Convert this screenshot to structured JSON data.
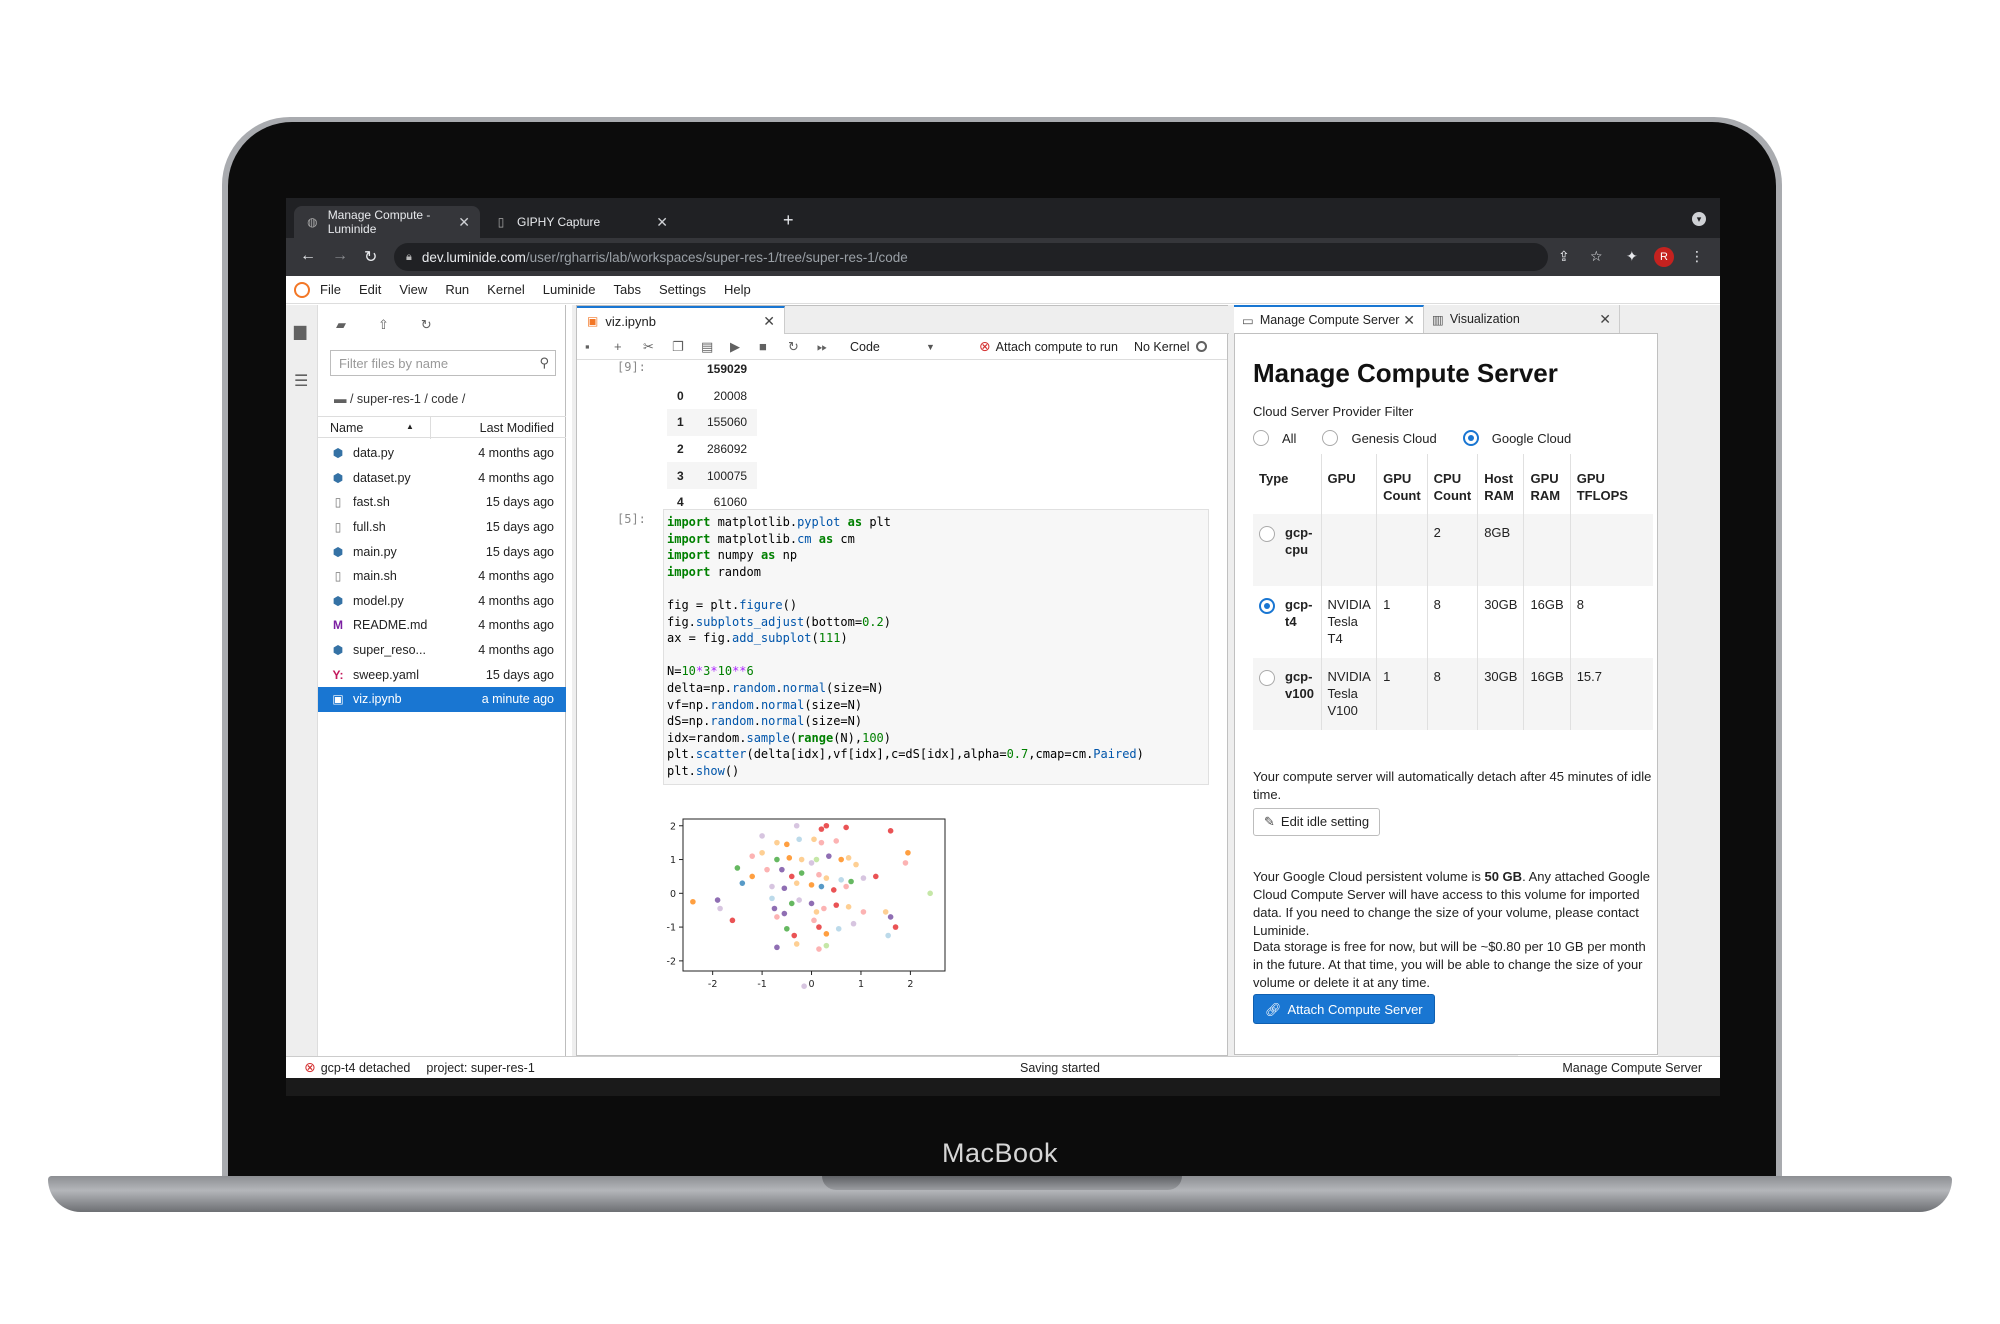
{
  "device": {
    "brand": "MacBook"
  },
  "browser": {
    "tabs": [
      {
        "title": "Manage Compute - Luminide",
        "active": true
      },
      {
        "title": "GIPHY Capture",
        "active": false
      }
    ],
    "url_host": "dev.luminide.com",
    "url_path": "/user/rgharris/lab/workspaces/super-res-1/tree/super-res-1/code",
    "profile_initial": "R"
  },
  "menubar": [
    "File",
    "Edit",
    "View",
    "Run",
    "Kernel",
    "Luminide",
    "Tabs",
    "Settings",
    "Help"
  ],
  "filebrowser": {
    "filter_placeholder": "Filter files by name",
    "breadcrumb": "/ super-res-1 / code /",
    "col_name": "Name",
    "col_modified": "Last Modified",
    "files": [
      {
        "name": "data.py",
        "modified": "4 months ago",
        "icon": "python-icon"
      },
      {
        "name": "dataset.py",
        "modified": "4 months ago",
        "icon": "python-icon"
      },
      {
        "name": "fast.sh",
        "modified": "15 days ago",
        "icon": "file-icon"
      },
      {
        "name": "full.sh",
        "modified": "15 days ago",
        "icon": "file-icon"
      },
      {
        "name": "main.py",
        "modified": "15 days ago",
        "icon": "python-icon"
      },
      {
        "name": "main.sh",
        "modified": "4 months ago",
        "icon": "file-icon"
      },
      {
        "name": "model.py",
        "modified": "4 months ago",
        "icon": "python-icon"
      },
      {
        "name": "README.md",
        "modified": "4 months ago",
        "icon": "markdown-icon"
      },
      {
        "name": "super_reso...",
        "modified": "4 months ago",
        "icon": "python-icon"
      },
      {
        "name": "sweep.yaml",
        "modified": "15 days ago",
        "icon": "yaml-icon"
      },
      {
        "name": "viz.ipynb",
        "modified": "a minute ago",
        "icon": "notebook-icon",
        "selected": true
      }
    ]
  },
  "notebook": {
    "tab_title": "viz.ipynb",
    "cell_type": "Code",
    "attach_label": "Attach compute to run",
    "kernel": "No Kernel",
    "output_prompt": "[9]:",
    "dataframe": {
      "header": "159029",
      "rows": [
        {
          "index": "0",
          "value": "20008"
        },
        {
          "index": "1",
          "value": "155060"
        },
        {
          "index": "2",
          "value": "286092"
        },
        {
          "index": "3",
          "value": "100075"
        },
        {
          "index": "4",
          "value": "61060"
        }
      ]
    },
    "code_prompt": "[5]:",
    "code_lines": [
      "import matplotlib.pyplot as plt",
      "import matplotlib.cm as cm",
      "import numpy as np",
      "import random",
      "",
      "fig = plt.figure()",
      "fig.subplots_adjust(bottom=0.2)",
      "ax = fig.add_subplot(111)",
      "",
      "N=10*3*10**6",
      "delta=np.random.normal(size=N)",
      "vf=np.random.normal(size=N)",
      "dS=np.random.normal(size=N)",
      "idx=random.sample(range(N),100)",
      "plt.scatter(delta[idx],vf[idx],c=dS[idx],alpha=0.7,cmap=cm.Paired)",
      "plt.show()"
    ]
  },
  "chart_data": {
    "type": "scatter",
    "xlim": [
      -2.6,
      2.7
    ],
    "ylim": [
      -2.3,
      2.2
    ],
    "xticks": [
      "-2",
      "-1",
      "0",
      "1",
      "2"
    ],
    "yticks": [
      "2",
      "1",
      "0",
      "-1",
      "-2"
    ],
    "xtick_values": [
      -2,
      -1,
      0,
      1,
      2
    ],
    "ytick_values": [
      2,
      1,
      0,
      -1,
      -2
    ],
    "colormap": [
      "#a6cee3",
      "#1f78b4",
      "#b2df8a",
      "#33a02c",
      "#fb9a99",
      "#e31a1c",
      "#fdbf6f",
      "#ff7f00",
      "#cab2d6",
      "#6a3d9a",
      "#ffff99",
      "#b15928"
    ],
    "points": [
      {
        "x": -1.0,
        "y": 1.7,
        "c": 8
      },
      {
        "x": -0.3,
        "y": 2.0,
        "c": 8
      },
      {
        "x": 0.2,
        "y": 1.9,
        "c": 5
      },
      {
        "x": 0.3,
        "y": 2.0,
        "c": 5
      },
      {
        "x": 0.7,
        "y": 1.95,
        "c": 5
      },
      {
        "x": 1.6,
        "y": 1.85,
        "c": 5
      },
      {
        "x": -0.7,
        "y": 1.5,
        "c": 6
      },
      {
        "x": -0.5,
        "y": 1.45,
        "c": 7
      },
      {
        "x": -0.25,
        "y": 1.6,
        "c": 0
      },
      {
        "x": 0.05,
        "y": 1.6,
        "c": 6
      },
      {
        "x": 0.2,
        "y": 1.5,
        "c": 4
      },
      {
        "x": 0.5,
        "y": 1.55,
        "c": 4
      },
      {
        "x": 1.95,
        "y": 1.2,
        "c": 7
      },
      {
        "x": 1.9,
        "y": 0.9,
        "c": 4
      },
      {
        "x": -1.2,
        "y": 1.1,
        "c": 4
      },
      {
        "x": -1.0,
        "y": 1.2,
        "c": 6
      },
      {
        "x": -0.7,
        "y": 1.0,
        "c": 3
      },
      {
        "x": -0.45,
        "y": 1.05,
        "c": 7
      },
      {
        "x": -0.2,
        "y": 1.0,
        "c": 6
      },
      {
        "x": 0.0,
        "y": 0.9,
        "c": 8
      },
      {
        "x": 0.1,
        "y": 1.0,
        "c": 2
      },
      {
        "x": 0.35,
        "y": 1.1,
        "c": 9
      },
      {
        "x": 0.6,
        "y": 1.0,
        "c": 7
      },
      {
        "x": 0.75,
        "y": 1.05,
        "c": 6
      },
      {
        "x": 0.9,
        "y": 0.85,
        "c": 6
      },
      {
        "x": 1.3,
        "y": 0.5,
        "c": 5
      },
      {
        "x": -1.5,
        "y": 0.75,
        "c": 3
      },
      {
        "x": -1.2,
        "y": 0.5,
        "c": 7
      },
      {
        "x": -0.9,
        "y": 0.7,
        "c": 4
      },
      {
        "x": -0.6,
        "y": 0.7,
        "c": 9
      },
      {
        "x": -0.4,
        "y": 0.5,
        "c": 5
      },
      {
        "x": -0.2,
        "y": 0.6,
        "c": 3
      },
      {
        "x": 0.15,
        "y": 0.55,
        "c": 4
      },
      {
        "x": 0.3,
        "y": 0.45,
        "c": 6
      },
      {
        "x": 0.6,
        "y": 0.4,
        "c": 0
      },
      {
        "x": 0.8,
        "y": 0.35,
        "c": 3
      },
      {
        "x": 1.05,
        "y": 0.45,
        "c": 8
      },
      {
        "x": -1.4,
        "y": 0.3,
        "c": 1
      },
      {
        "x": -0.8,
        "y": 0.2,
        "c": 8
      },
      {
        "x": -0.55,
        "y": 0.15,
        "c": 9
      },
      {
        "x": -0.3,
        "y": 0.3,
        "c": 6
      },
      {
        "x": 0.0,
        "y": 0.25,
        "c": 7
      },
      {
        "x": 0.2,
        "y": 0.2,
        "c": 1
      },
      {
        "x": 0.45,
        "y": 0.1,
        "c": 5
      },
      {
        "x": 0.7,
        "y": 0.2,
        "c": 4
      },
      {
        "x": 2.4,
        "y": 0.0,
        "c": 2
      },
      {
        "x": -2.4,
        "y": -0.25,
        "c": 7
      },
      {
        "x": -1.9,
        "y": -0.2,
        "c": 9
      },
      {
        "x": -1.85,
        "y": -0.45,
        "c": 8
      },
      {
        "x": -1.6,
        "y": -0.8,
        "c": 5
      },
      {
        "x": -0.8,
        "y": -0.15,
        "c": 0
      },
      {
        "x": -0.75,
        "y": -0.45,
        "c": 9
      },
      {
        "x": -0.7,
        "y": -0.7,
        "c": 4
      },
      {
        "x": -0.55,
        "y": -0.6,
        "c": 9
      },
      {
        "x": -0.4,
        "y": -0.3,
        "c": 3
      },
      {
        "x": -0.25,
        "y": -0.2,
        "c": 8
      },
      {
        "x": 0.0,
        "y": -0.3,
        "c": 9
      },
      {
        "x": 0.1,
        "y": -0.55,
        "c": 6
      },
      {
        "x": 0.25,
        "y": -0.45,
        "c": 4
      },
      {
        "x": 0.5,
        "y": -0.35,
        "c": 5
      },
      {
        "x": 0.75,
        "y": -0.4,
        "c": 6
      },
      {
        "x": 1.05,
        "y": -0.55,
        "c": 4
      },
      {
        "x": 1.6,
        "y": -0.7,
        "c": 9
      },
      {
        "x": 1.7,
        "y": -1.0,
        "c": 5
      },
      {
        "x": 1.5,
        "y": -0.55,
        "c": 6
      },
      {
        "x": -0.5,
        "y": -1.05,
        "c": 3
      },
      {
        "x": -0.35,
        "y": -1.25,
        "c": 5
      },
      {
        "x": 0.05,
        "y": -0.8,
        "c": 4
      },
      {
        "x": 0.15,
        "y": -1.0,
        "c": 5
      },
      {
        "x": 0.3,
        "y": -1.2,
        "c": 7
      },
      {
        "x": 0.55,
        "y": -1.05,
        "c": 0
      },
      {
        "x": 0.85,
        "y": -0.9,
        "c": 8
      },
      {
        "x": 1.55,
        "y": -1.25,
        "c": 0
      },
      {
        "x": -0.7,
        "y": -1.6,
        "c": 9
      },
      {
        "x": -0.3,
        "y": -1.5,
        "c": 6
      },
      {
        "x": 0.15,
        "y": -1.65,
        "c": 4
      },
      {
        "x": 0.3,
        "y": -1.55,
        "c": 2
      },
      {
        "x": -0.15,
        "y": -2.75,
        "c": 8
      }
    ]
  },
  "right_panel": {
    "tabs": [
      {
        "title": "Manage Compute Server",
        "active": true
      },
      {
        "title": "Visualization",
        "active": false
      }
    ],
    "title": "Manage Compute Server",
    "filter_label": "Cloud Server Provider Filter",
    "filter_options": [
      {
        "label": "All",
        "selected": false
      },
      {
        "label": "Genesis Cloud",
        "selected": false
      },
      {
        "label": "Google Cloud",
        "selected": true
      }
    ],
    "table_headers": [
      "Type",
      "GPU",
      "GPU Count",
      "CPU Count",
      "Host RAM",
      "GPU RAM",
      "GPU TFLOPS"
    ],
    "servers": [
      {
        "type": "gcp-cpu",
        "gpu": "",
        "gpu_count": "",
        "cpu_count": "2",
        "host_ram": "8GB",
        "gpu_ram": "",
        "tflops": "",
        "selected": false
      },
      {
        "type": "gcp-t4",
        "gpu": "NVIDIA Tesla T4",
        "gpu_count": "1",
        "cpu_count": "8",
        "host_ram": "30GB",
        "gpu_ram": "16GB",
        "tflops": "8",
        "selected": true
      },
      {
        "type": "gcp-v100",
        "gpu": "NVIDIA Tesla V100",
        "gpu_count": "1",
        "cpu_count": "8",
        "host_ram": "30GB",
        "gpu_ram": "16GB",
        "tflops": "15.7",
        "selected": false
      }
    ],
    "idle_text": "Your compute server will automatically detach after 45 minutes of idle time.",
    "edit_idle_label": "Edit idle setting",
    "volume_text_before": "Your Google Cloud persistent volume is ",
    "volume_size": "50 GB",
    "volume_text_after": ". Any attached Google Cloud Compute Server will have access to this volume for imported data. If you need to change the size of your volume, please contact Luminide.",
    "storage_text": "Data storage is free for now, but will be ~$0.80 per 10 GB per month in the future. At that time, you will be able to change the size of your volume or delete it at any time.",
    "attach_button": "Attach Compute Server"
  },
  "statusbar": {
    "server_status": "gcp-t4 detached",
    "project": "project: super-res-1",
    "center": "Saving started",
    "right": "Manage Compute Server"
  },
  "colors": {
    "accent": "#1976d2",
    "error": "#d32f2f",
    "jupyter": "#f37726"
  }
}
